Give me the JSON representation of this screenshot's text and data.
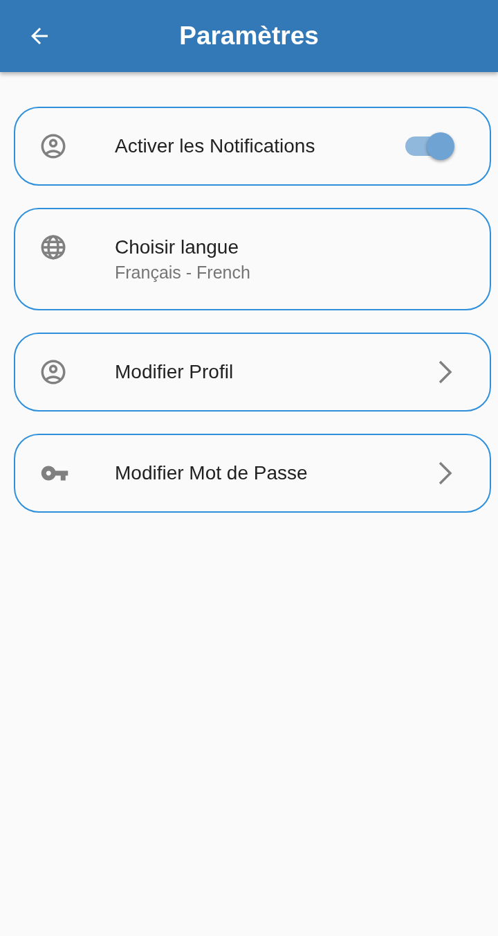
{
  "app_bar": {
    "title": "Paramètres"
  },
  "items": [
    {
      "kind": "switch",
      "title": "Activer les Notifications",
      "on": true
    },
    {
      "kind": "subtitle",
      "title": "Choisir langue",
      "subtitle": "Français - French"
    },
    {
      "kind": "link",
      "title": "Modifier Profil"
    },
    {
      "kind": "link",
      "title": "Modifier Mot de Passe"
    }
  ]
}
